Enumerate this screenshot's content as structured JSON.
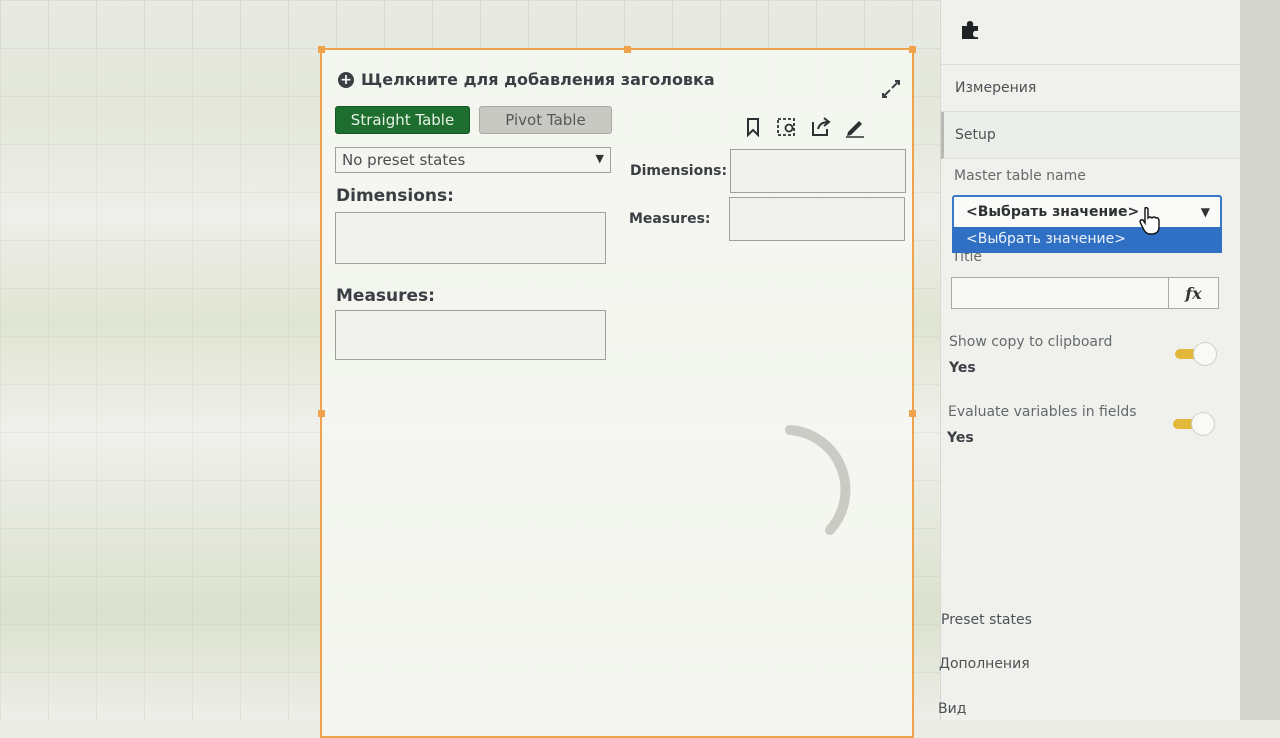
{
  "object": {
    "title_placeholder": "Щелкните для добавления заголовка",
    "buttons": {
      "straight_table": "Straight Table",
      "pivot_table": "Pivot Table"
    },
    "preset_select": {
      "value": "No preset states"
    },
    "dimensions_label": "Dimensions:",
    "measures_label": "Measures:",
    "side_dimensions_label": "Dimensions:",
    "side_measures_label": "Measures:",
    "toolbar_icons": [
      "bookmark-icon",
      "selection-icon",
      "export-icon",
      "pencil-icon"
    ]
  },
  "panel": {
    "top_icon": "puzzle-icon",
    "sections": [
      "Измерения",
      "Setup"
    ],
    "master_table": {
      "label": "Master table name",
      "selected": "<Выбрать значение>",
      "option": "<Выбрать значение>"
    },
    "title_field": {
      "label": "Title",
      "fx": "fx"
    },
    "copy_clipboard": {
      "label": "Show copy to clipboard",
      "value": "Yes",
      "enabled": true
    },
    "evaluate_vars": {
      "label": "Evaluate variables in fields",
      "value": "Yes",
      "enabled": true
    },
    "bottom_sections": [
      "Preset states",
      "Дополнения",
      "Вид"
    ]
  },
  "colors": {
    "selection_border": "#f0a24c",
    "straight_button": "#1e6e2f",
    "dropdown_focus": "#3c78c8",
    "dropdown_option": "#2f6fc4",
    "toggle_on": "#e2b83a"
  }
}
